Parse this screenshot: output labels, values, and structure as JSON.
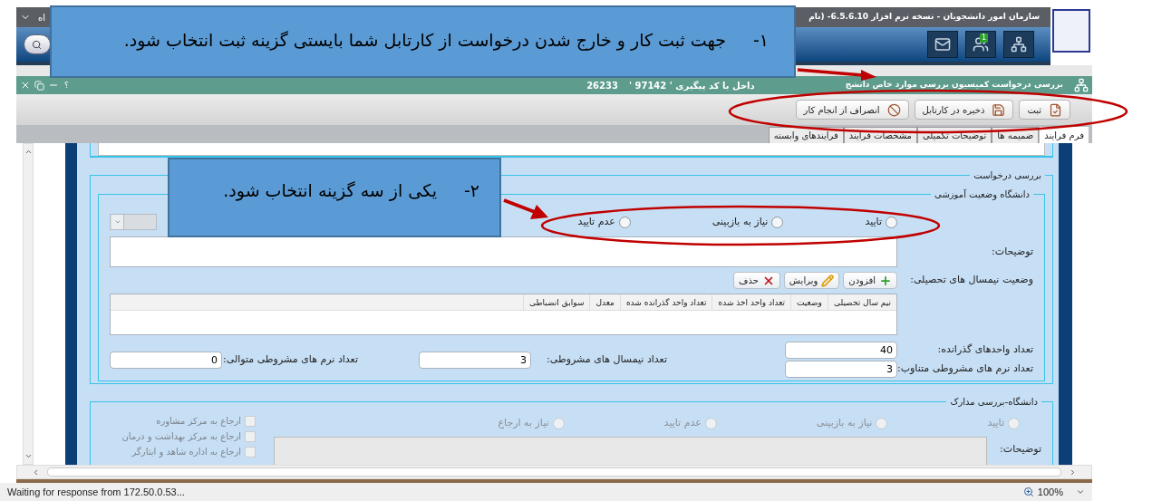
{
  "header": {
    "title": "سازمان امور دانشجویان  -  نسخه نرم افزار  6.5.6.10- (نام",
    "left_text": "اه",
    "notification_count": "1"
  },
  "task_bar": {
    "title": "بررسی درخواست کمیسیون بررسی موارد خاص دانشج",
    "title_rest": "داخل با کد پیگیری ' 97142 '",
    "tracking": "26233",
    "help_label": "؟"
  },
  "toolbar": {
    "buttons": [
      {
        "kind": "submit",
        "label": "ثبت"
      },
      {
        "kind": "save",
        "label": "ذخیره در کارتابل"
      },
      {
        "kind": "cancel",
        "label": "انصراف از انجام کار"
      }
    ]
  },
  "tabs": [
    {
      "label": "فرم فرایند",
      "selected": true
    },
    {
      "label": "ضمیمه ها",
      "selected": false
    },
    {
      "label": "توضیحات تکمیلی",
      "selected": false
    },
    {
      "label": "مشخصات فرایند",
      "selected": false
    },
    {
      "label": "فرایندهای وابسته",
      "selected": false
    }
  ],
  "review": {
    "legend": "بررسی درخواست",
    "education": {
      "legend": "دانشگاه وضعیت آموزشی",
      "options": [
        {
          "label": "تایید",
          "selected": false
        },
        {
          "label": "نیاز به بازبینی",
          "selected": false
        },
        {
          "label": "عدم تایید",
          "selected": false
        }
      ],
      "notes_label": "توضیحات:",
      "semesters_label": "وضعیت نیمسال های تحصیلی:",
      "actions": [
        {
          "kind": "add",
          "label": "افزودن"
        },
        {
          "kind": "edit",
          "label": "ویرایش"
        },
        {
          "kind": "delete",
          "label": "حذف"
        }
      ],
      "columns": [
        "نیم سال تحصیلی",
        "وضعیت",
        "تعداد واحد اخذ شده",
        "تعداد واحد گذرانده شده",
        "معدل",
        "سوابق انضباطی"
      ],
      "field_columns": [
        [
          {
            "label": "تعداد واحدهای گذرانده:",
            "value": "40"
          },
          {
            "label": "تعداد نرم های مشروطی متناوب:",
            "value": "3"
          }
        ],
        [
          {
            "label": "تعداد نیمسال های مشروطی:",
            "value": "3"
          }
        ],
        [
          {
            "label": "تعداد نرم های مشروطی متوالی:",
            "value": "0"
          }
        ]
      ]
    },
    "documents": {
      "legend": "دانشگاه-بررسی مدارک",
      "options": [
        {
          "label": "تایید",
          "selected": false,
          "disabled": true
        },
        {
          "label": "نیاز به بازبینی",
          "selected": false,
          "disabled": true
        },
        {
          "label": "عدم تایید",
          "selected": false,
          "disabled": true
        },
        {
          "label": "نیاز به ارجاع",
          "selected": false,
          "disabled": true
        }
      ],
      "referrals": [
        {
          "label": "ارجاع به مرکز مشاوره",
          "checked": false,
          "disabled": true
        },
        {
          "label": "ارجاع به مرکز بهداشت و درمان",
          "checked": false,
          "disabled": true
        },
        {
          "label": "ارجاع به اداره شاهد و ایثارگر",
          "checked": false,
          "disabled": true
        }
      ],
      "notes_label": "توضیحات:"
    }
  },
  "status_bar": {
    "message": "Waiting for response from 172.50.0.53...",
    "zoom": "100%"
  },
  "callouts": [
    {
      "number": "١-",
      "text": "جهت ثبت کار و خارج شدن درخواست از کارتابل شما بایستی گزینه ثبت انتخاب شود."
    },
    {
      "number": "٢-",
      "text": "یکی از سه گزینه انتخاب شود."
    }
  ]
}
